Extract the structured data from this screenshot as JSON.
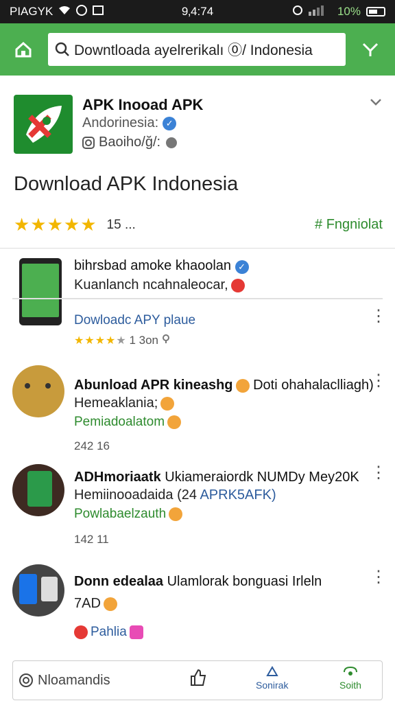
{
  "status": {
    "carrier": "PIAGYK",
    "time": "9‚4:74",
    "battery": "10%"
  },
  "topbar": {
    "search_value": "Downtloada ayelrerikalı  ⓪/ Indonesia"
  },
  "app": {
    "name": "APK Inooad APK",
    "developer": "Andorinesia:",
    "meta": "Baoiho/ğ/:",
    "page_title": "Download APK Indonesia",
    "rating": 5,
    "rating_count": "15 ...",
    "rating_action": "# Fngniolat"
  },
  "posts": [
    {
      "title": "bihrsbad amoke khaoolan",
      "line2": "Kuanlanch ncahnaleocar,",
      "line3": "Dowloadc APY plaue",
      "meta_stars": 4,
      "meta": "1 3on"
    },
    {
      "title": "Abunload APR kineashg",
      "title_suffix": "Doti ohahalaclliagh)",
      "line2": "Hemeaklania;",
      "line3": "Pemiadoalatom",
      "meta": "242    16"
    },
    {
      "title": "ADHmoriaatk",
      "title_suffix": "Ukiameraiordk NUMDy Mey20K",
      "line2": "Hemiinooadaida (24",
      "line2_suffix": "APRK5AFK)",
      "line3": "Powlabaelzauth",
      "meta": "142    11"
    },
    {
      "title": "Donn edealaa",
      "title_suffix": "Ulamlorak bonguasi Irleln",
      "line2": "7AD",
      "line3": "Pahlia"
    }
  ],
  "bottom": {
    "comment_label": "Nloamandis",
    "share_label": "Sonirak",
    "save_label": "Soith"
  },
  "colors": {
    "accent_green": "#4caf50",
    "link_blue": "#2d5c9d",
    "star": "#f2b600"
  }
}
